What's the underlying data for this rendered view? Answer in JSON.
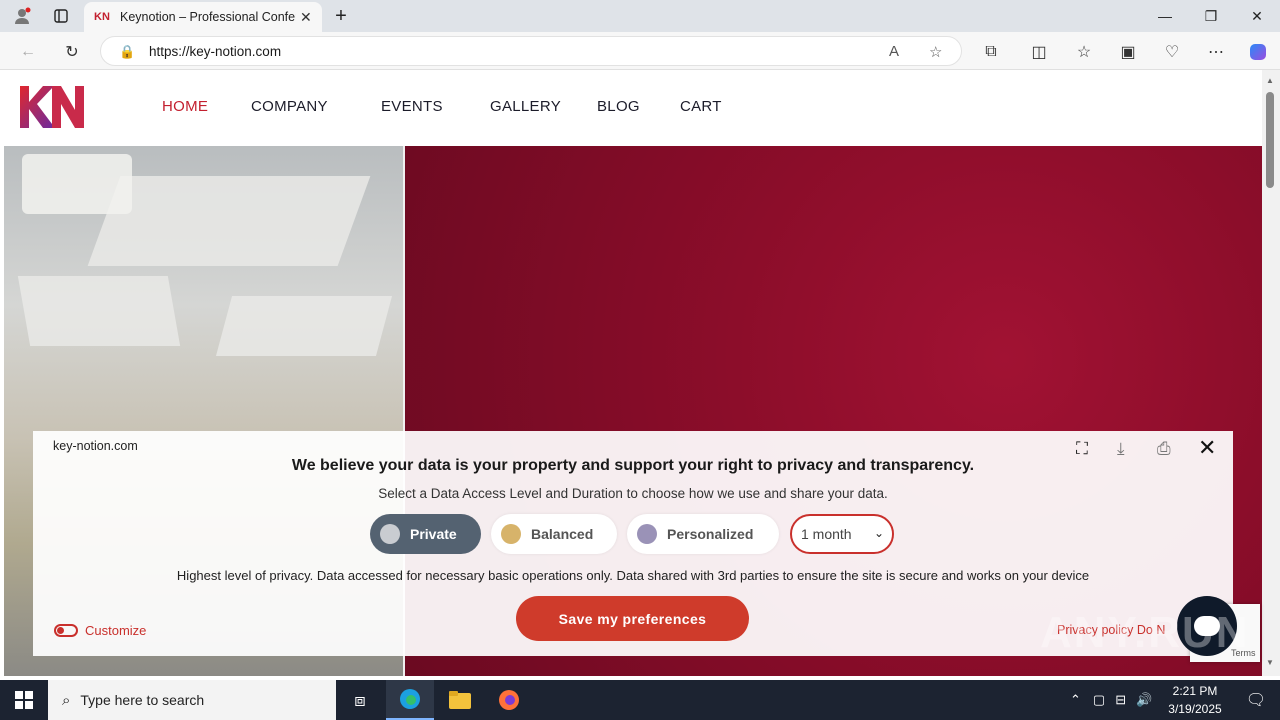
{
  "browser": {
    "tab_title": "Keynotion – Professional Confere",
    "tab_favicon": "KN",
    "url": "https://key-notion.com",
    "new_tab": "+"
  },
  "site": {
    "nav": [
      {
        "label": "HOME",
        "active": true
      },
      {
        "label": "COMPANY",
        "active": false
      },
      {
        "label": "EVENTS",
        "active": false
      },
      {
        "label": "GALLERY",
        "active": false
      },
      {
        "label": "BLOG",
        "active": false
      },
      {
        "label": "CART",
        "active": false
      }
    ]
  },
  "consent": {
    "domain": "key-notion.com",
    "heading": "We believe your data is your property and support your right to privacy and transparency.",
    "subheading": "Select a Data Access Level and Duration to choose how we use and share your data.",
    "levels": [
      {
        "label": "Private",
        "dot_color": "#c9ccd1",
        "selected": true
      },
      {
        "label": "Balanced",
        "dot_color": "#d7b36a",
        "selected": false
      },
      {
        "label": "Personalized",
        "dot_color": "#9a92b7",
        "selected": false
      }
    ],
    "duration": "1 month",
    "description": "Highest level of privacy. Data accessed for necessary basic operations only. Data shared with 3rd parties to ensure the site is secure and works on your device",
    "save_label": "Save my preferences",
    "customize_label": "Customize",
    "privacy_links": "Privacy policy   Do N"
  },
  "recaptcha": {
    "terms": "Terms"
  },
  "watermark": "ANY.RUN",
  "taskbar": {
    "search_placeholder": "Type here to search",
    "time": "2:21 PM",
    "date": "3/19/2025"
  },
  "colors": {
    "accent": "#c3202f",
    "button": "#cf3b2b",
    "private_pill": "#546271"
  }
}
